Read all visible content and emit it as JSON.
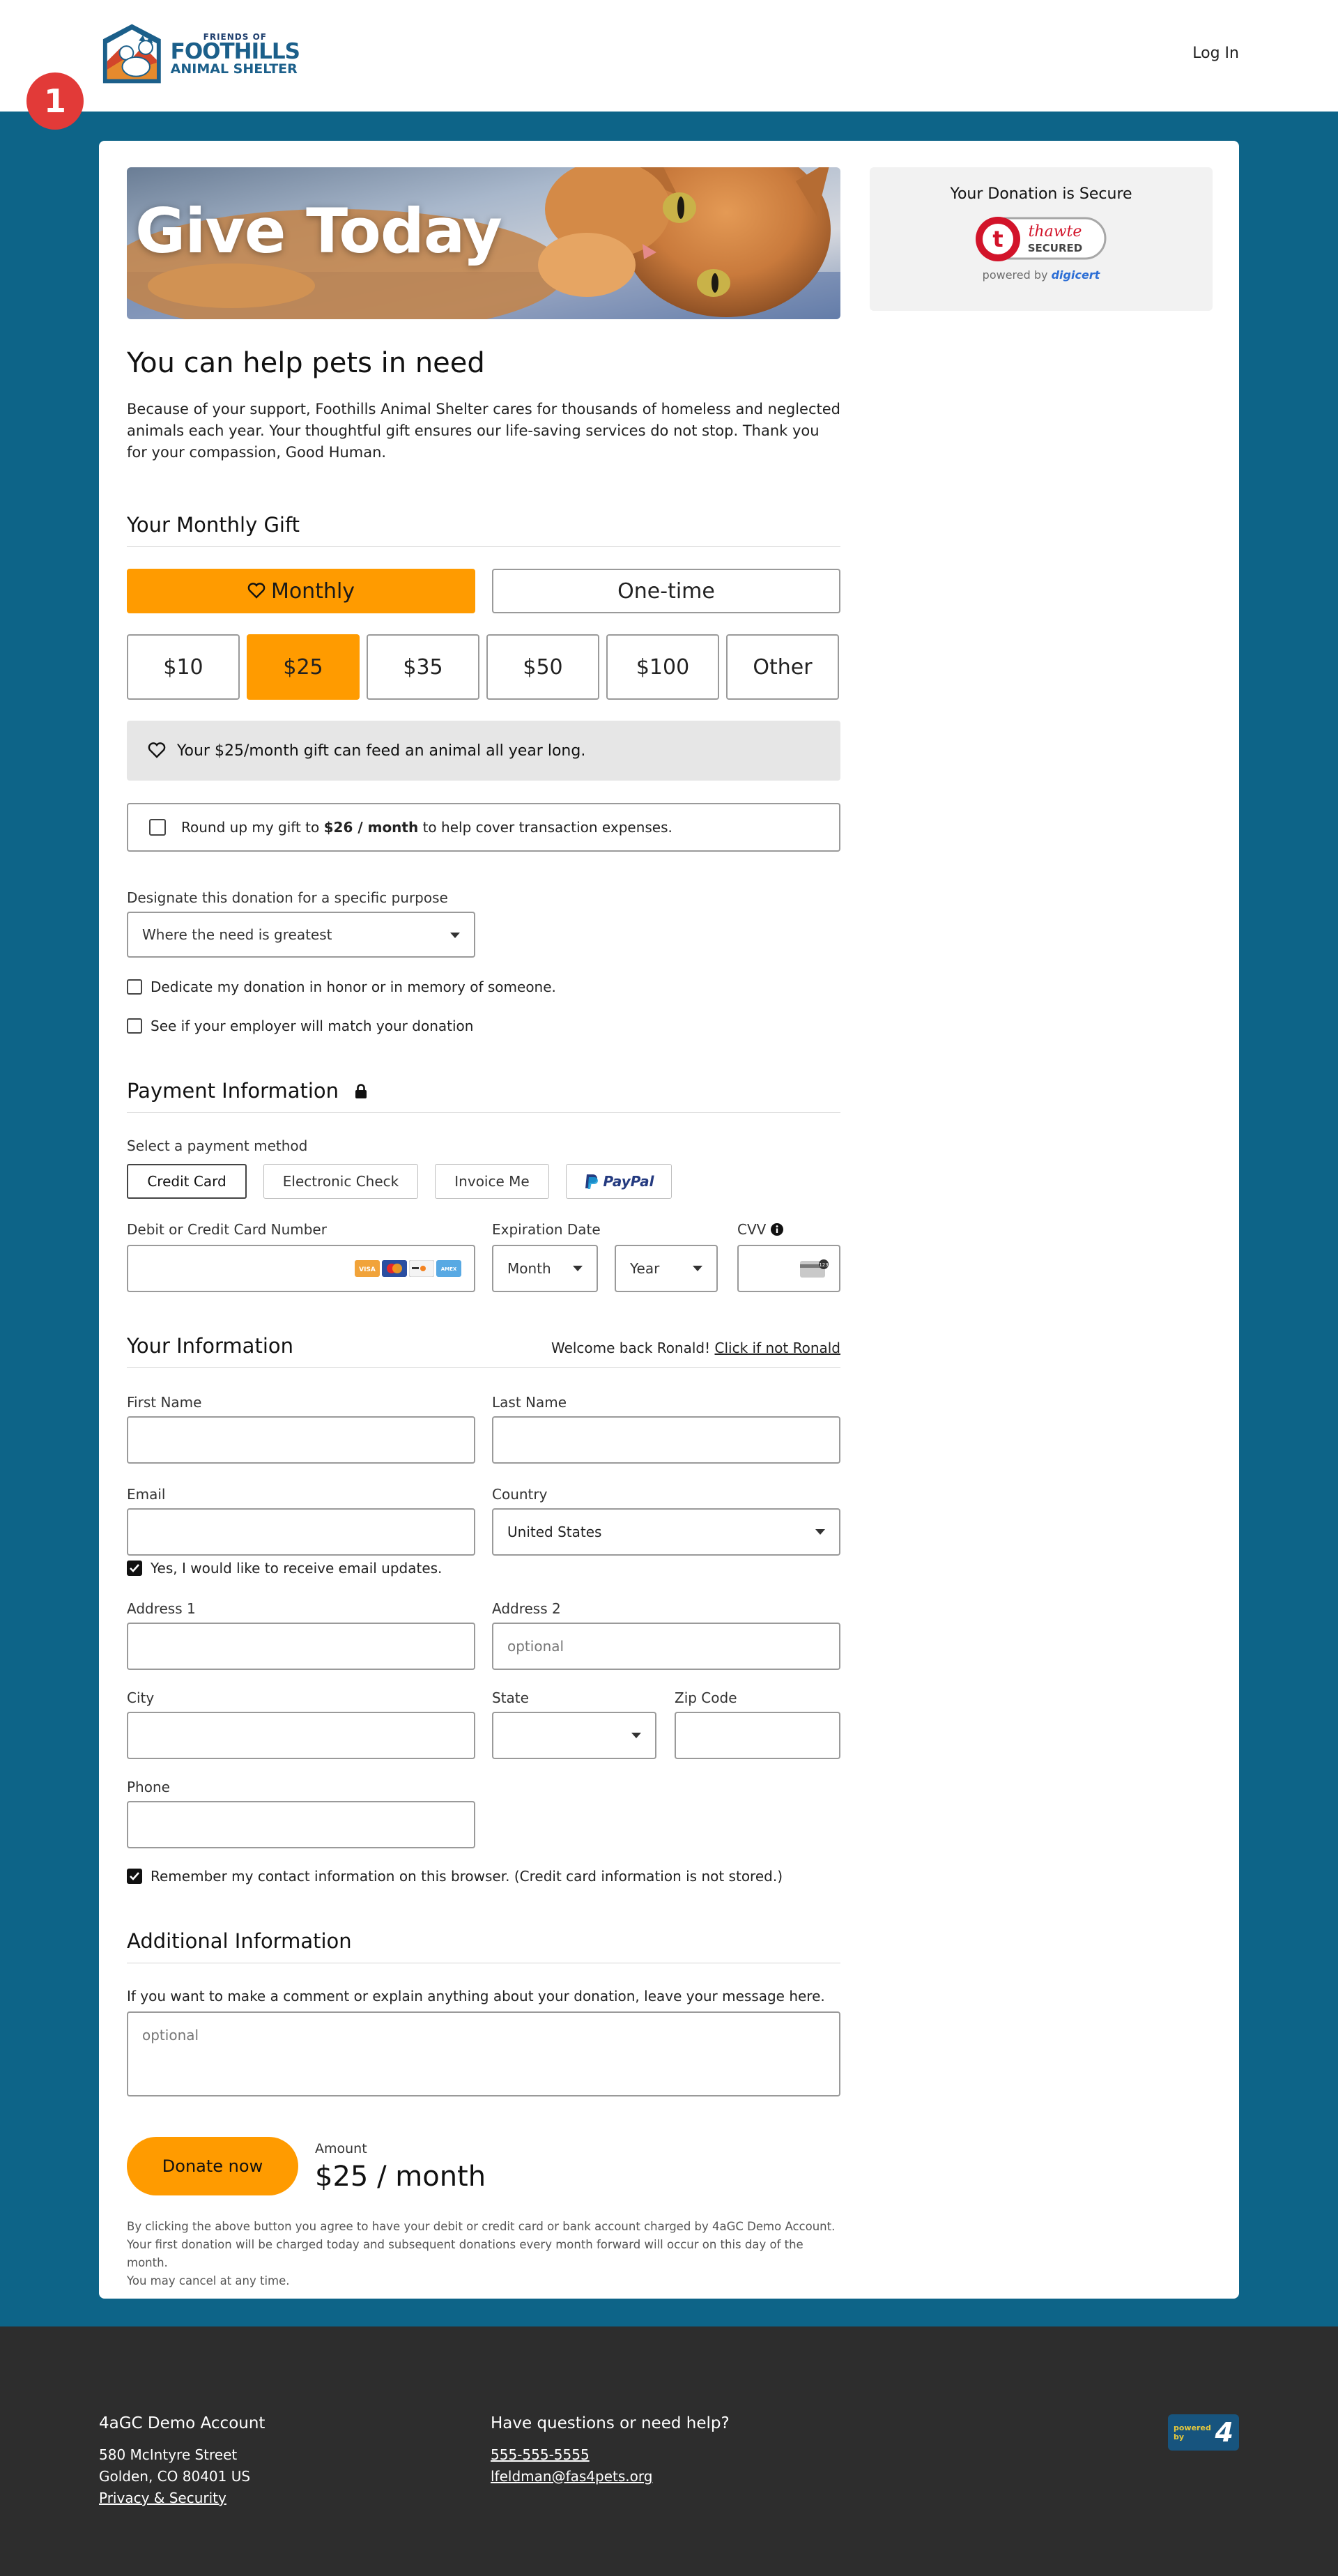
{
  "header": {
    "logo_friends": "FRIENDS OF",
    "logo_foothills": "FOOTHILLS",
    "logo_shelter": "ANIMAL SHELTER",
    "login_label": "Log In",
    "step_badge": "1"
  },
  "hero": {
    "title": "Give Today"
  },
  "secure": {
    "title": "Your Donation is Secure",
    "powered_by": "powered by",
    "digicert": "digicert",
    "seal_thawte": "thawte",
    "seal_secured": "SECURED"
  },
  "intro": {
    "heading": "You can help pets in need",
    "body": "Because of your support, Foothills Animal Shelter cares for thousands of homeless and neglected animals each year. Your thoughtful gift ensures our life-saving services do not stop. Thank you for your compassion, Good Human."
  },
  "gift": {
    "heading": "Your Monthly Gift",
    "frequency": [
      {
        "label": "Monthly",
        "selected": true
      },
      {
        "label": "One-time",
        "selected": false
      }
    ],
    "amounts": [
      {
        "label": "$10",
        "selected": false
      },
      {
        "label": "$25",
        "selected": true
      },
      {
        "label": "$35",
        "selected": false
      },
      {
        "label": "$50",
        "selected": false
      },
      {
        "label": "$100",
        "selected": false
      },
      {
        "label": "Other",
        "selected": false
      }
    ],
    "impact_message": "Your $25/month gift can feed an animal all year long.",
    "roundup_pre": "Round up my gift to ",
    "roundup_amount": "$26 / month",
    "roundup_post": " to help cover transaction expenses.",
    "roundup_checked": false
  },
  "designation": {
    "label": "Designate this donation for a specific purpose",
    "selected": "Where the need is greatest",
    "dedicate_label": "Dedicate my donation in honor or in memory of someone.",
    "employer_label": "See if your employer will match your donation"
  },
  "payment": {
    "heading": "Payment Information",
    "method_label": "Select a payment method",
    "methods": [
      {
        "label": "Credit Card",
        "selected": true
      },
      {
        "label": "Electronic Check",
        "selected": false
      },
      {
        "label": "Invoice Me",
        "selected": false
      },
      {
        "label": "PayPal",
        "selected": false
      }
    ],
    "card_number_label": "Debit or Credit Card Number",
    "card_number_value": "",
    "card_brands": [
      "VISA",
      "MC",
      "DISC",
      "AMEX"
    ],
    "expiration_label": "Expiration Date",
    "month_placeholder": "Month",
    "year_placeholder": "Year",
    "cvv_label": "CVV"
  },
  "your_info": {
    "heading": "Your Information",
    "welcome_text": "Welcome back Ronald! ",
    "not_you_link": "Click if not Ronald",
    "first_name_label": "First Name",
    "first_name_value": "",
    "last_name_label": "Last Name",
    "last_name_value": "",
    "email_label": "Email",
    "email_value": "",
    "email_updates_label": "Yes, I would like to receive email updates.",
    "email_updates_checked": true,
    "country_label": "Country",
    "country_value": "United States",
    "address1_label": "Address 1",
    "address1_value": "",
    "address2_label": "Address 2",
    "address2_placeholder": "optional",
    "city_label": "City",
    "city_value": "",
    "state_label": "State",
    "state_value": "",
    "zip_label": "Zip Code",
    "zip_value": "",
    "phone_label": "Phone",
    "phone_value": "",
    "remember_label": "Remember my contact information on this browser. (Credit card information is not stored.)",
    "remember_checked": true
  },
  "additional": {
    "heading": "Additional Information",
    "prompt": "If you want to make a comment or explain anything about your donation, leave your message here.",
    "placeholder": "optional"
  },
  "submit": {
    "button_label": "Donate now",
    "amount_label": "Amount",
    "amount_value": "$25 / month",
    "legal_line1": "By clicking the above button you agree to have your debit or credit card or bank account charged by 4aGC Demo Account.",
    "legal_line2": "Your first donation will be charged today and subsequent donations every month forward will occur on this day of the month.",
    "legal_line3": "You may cancel at any time."
  },
  "footer": {
    "org_name": "4aGC Demo Account",
    "address_line1": "580 McIntyre Street",
    "address_line2": "Golden, CO 80401 US",
    "privacy_link": "Privacy & Security",
    "help_heading": "Have questions or need help?",
    "phone_link": "555-555-5555",
    "email_link": "lfeldman@fas4pets.org",
    "powered_by": "powered by",
    "powered_mark": "4"
  },
  "colors": {
    "brand_blue": "#0d6488",
    "accent_orange": "#ff9b00",
    "alert_red": "#e23a38",
    "footer_bg": "#2d2d2d"
  }
}
